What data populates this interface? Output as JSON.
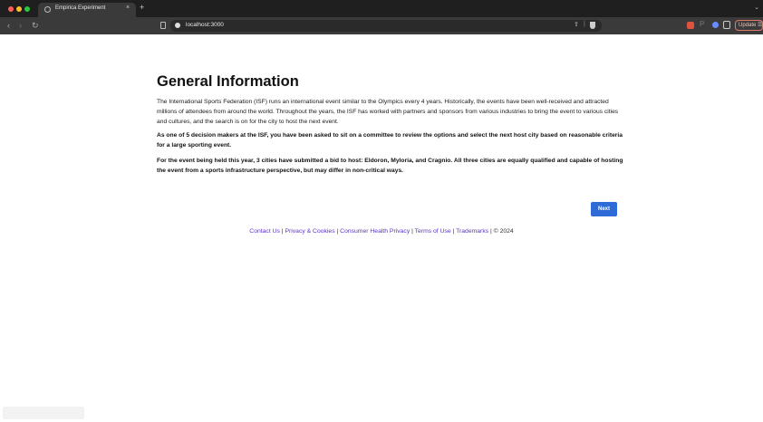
{
  "browser": {
    "tab_title": "Empirica Experiment",
    "tab_close": "×",
    "new_tab": "+",
    "url": "localhost:3000",
    "update_label": "Update",
    "update_icon": "☰"
  },
  "icons": {
    "back": "‹",
    "forward": "›",
    "reload": "↻",
    "share": "⇧",
    "tab_chevron": "⌄"
  },
  "page": {
    "title": "General Information",
    "paragraphs": [
      "The International Sports Federation (ISF) runs an international event similar to the Olympics every 4 years. Historically, the events have been well-received and attracted millions of attendees from around the world. Throughout the years, the ISF has worked with partners and sponsors from various industries to bring the event to various cities and cultures, and the search is on for the city to host the next event.",
      "As one of 5 decision makers at the ISF, you have been asked to sit on a committee to review the options and select the next host city based on reasonable criteria for a large sporting event.",
      "For the event being held this year, 3 cities have submitted a bid to host: Eldoron, Myloria, and Cragnio. All three cities are equally qualified and capable of hosting the event from a sports infrastructure perspective, but may differ in non-critical ways."
    ],
    "next_label": "Next"
  },
  "footer": {
    "links": [
      "Contact Us",
      "Privacy & Cookies",
      "Consumer Health Privacy",
      "Terms of Use",
      "Trademarks"
    ],
    "separator": "|",
    "copyright": "© 2024"
  },
  "colors": {
    "link": "#5b32c8",
    "button": "#2e6bd6"
  }
}
